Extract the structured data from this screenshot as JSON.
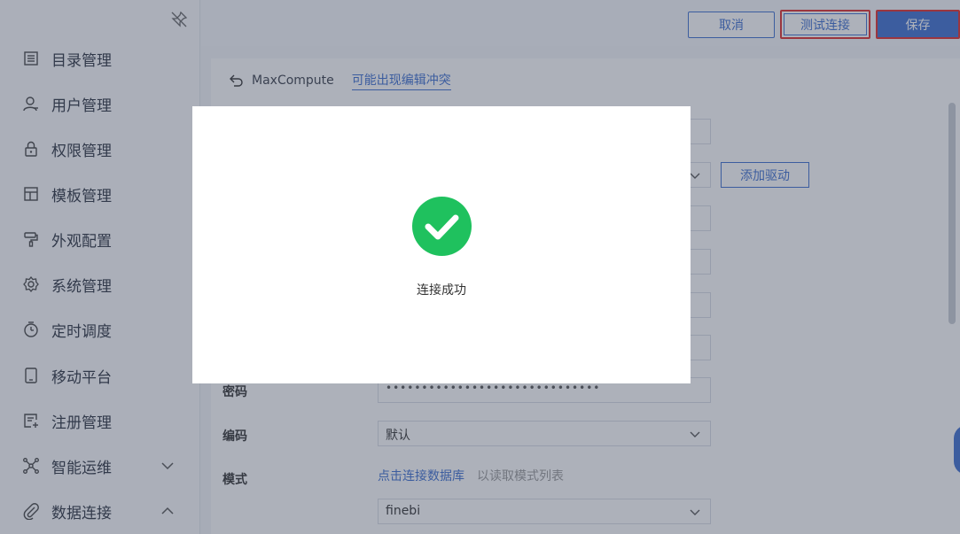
{
  "sidebar": {
    "items": [
      {
        "label": "目录管理"
      },
      {
        "label": "用户管理"
      },
      {
        "label": "权限管理"
      },
      {
        "label": "模板管理"
      },
      {
        "label": "外观配置"
      },
      {
        "label": "系统管理"
      },
      {
        "label": "定时调度"
      },
      {
        "label": "移动平台"
      },
      {
        "label": "注册管理"
      },
      {
        "label": "智能运维"
      },
      {
        "label": "数据连接"
      }
    ]
  },
  "toolbar": {
    "cancel_label": "取消",
    "test_label": "测试连接",
    "save_label": "保存"
  },
  "breadcrumb": {
    "name": "MaxCompute",
    "warning": "可能出现编辑冲突"
  },
  "form": {
    "add_driver_label": "添加驱动",
    "password_label": "密码",
    "password_value": "••••••••••••••••••••••••••••••",
    "encoding_label": "编码",
    "encoding_value": "默认",
    "schema_label": "模式",
    "connect_link": "点击连接数据库",
    "schema_hint": "以读取模式列表",
    "schema_value": "finebi"
  },
  "dialog": {
    "message": "连接成功",
    "icon": "check-circle-icon"
  },
  "colors": {
    "accent": "#3d6fd1",
    "success": "#1fc15e",
    "highlight": "#e02b2b"
  }
}
